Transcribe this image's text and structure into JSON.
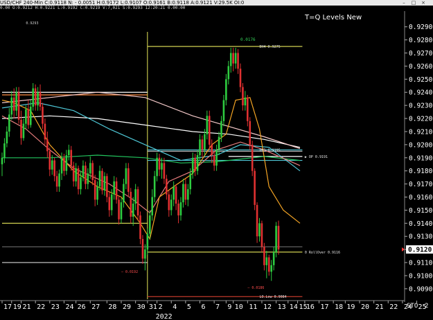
{
  "window": {
    "title": "USD/CHF  240-Min  C:0.9118  N: - 0.0051  H:0.9172  L:0.9107  O:0.9161  B:0.9118  A:0.9121  V:29.5K  OI:0",
    "ohlc_line": "0.00  O:0.9212  H:0.9221  L:0.9192  C:0.9219  V:7,021  S:0.9293  12:20:21  0.00:00",
    "controls": [
      "–",
      "□",
      "×"
    ]
  },
  "indicator_name": "T=Q Levels New",
  "chart_data": {
    "type": "candlestick",
    "symbol": "USD/CHF",
    "interval": "240-Min",
    "ylim": [
      0.9082,
      0.9302
    ],
    "y_ticks": [
      "0.9290",
      "0.9280",
      "0.9270",
      "0.9260",
      "0.9250",
      "0.9240",
      "0.9230",
      "0.9220",
      "0.9210",
      "0.9200",
      "0.9190",
      "0.9180",
      "0.9170",
      "0.9160",
      "0.9150",
      "0.9140",
      "0.9130",
      "0.9120",
      "0.9110",
      "0.9100",
      "0.9090"
    ],
    "x_labels": [
      {
        "label": "17",
        "i": 0
      },
      {
        "label": "19",
        "i": 4
      },
      {
        "label": "21",
        "i": 8
      },
      {
        "label": "22",
        "i": 14
      },
      {
        "label": "23",
        "i": 20
      },
      {
        "label": "24",
        "i": 26
      },
      {
        "label": "26",
        "i": 31
      },
      {
        "label": "27",
        "i": 37
      },
      {
        "label": "28",
        "i": 44
      },
      {
        "label": "29",
        "i": 50
      },
      {
        "label": "30",
        "i": 56
      },
      {
        "label": "31",
        "i": 61
      },
      {
        "label": "2",
        "i": 65
      },
      {
        "label": "4",
        "i": 71
      },
      {
        "label": "5",
        "i": 77
      },
      {
        "label": "6",
        "i": 83
      },
      {
        "label": "7",
        "i": 89
      },
      {
        "label": "9",
        "i": 94
      },
      {
        "label": "10",
        "i": 97
      },
      {
        "label": "11",
        "i": 103
      },
      {
        "label": "12",
        "i": 109
      },
      {
        "label": "13",
        "i": 115
      },
      {
        "label": "14",
        "i": 120
      },
      {
        "label": "15",
        "i": 124
      },
      {
        "label": "16",
        "i": 127
      },
      {
        "label": "17",
        "i": 133
      },
      {
        "label": "18",
        "i": 139
      },
      {
        "label": "19",
        "i": 144
      },
      {
        "label": "20",
        "i": 150
      },
      {
        "label": "21",
        "i": 156
      },
      {
        "label": "22",
        "i": 162
      },
      {
        "label": "24",
        "i": 168
      },
      {
        "label": "25",
        "i": 174
      }
    ],
    "year_label": "2022",
    "year_label_i": 65,
    "last_price": "0.9120",
    "last_label_left": "STO",
    "last_label_right": "2",
    "candles": [
      [
        0.9185,
        0.9194,
        0.9176,
        0.919
      ],
      [
        0.919,
        0.9205,
        0.9186,
        0.9201
      ],
      [
        0.9201,
        0.9214,
        0.9198,
        0.921
      ],
      [
        0.921,
        0.9228,
        0.9206,
        0.9223
      ],
      [
        0.9223,
        0.9241,
        0.9219,
        0.9236
      ],
      [
        0.9236,
        0.9243,
        0.922,
        0.9226
      ],
      [
        0.9226,
        0.9244,
        0.9222,
        0.924
      ],
      [
        0.924,
        0.9244,
        0.9216,
        0.9219
      ],
      [
        0.9219,
        0.9226,
        0.92,
        0.9205
      ],
      [
        0.9205,
        0.922,
        0.9203,
        0.9216
      ],
      [
        0.9216,
        0.923,
        0.9212,
        0.9227
      ],
      [
        0.9227,
        0.9234,
        0.9212,
        0.9215
      ],
      [
        0.9215,
        0.9234,
        0.9213,
        0.9229
      ],
      [
        0.9229,
        0.9247,
        0.9226,
        0.9243
      ],
      [
        0.9243,
        0.9246,
        0.9226,
        0.923
      ],
      [
        0.923,
        0.9244,
        0.9226,
        0.924
      ],
      [
        0.924,
        0.9246,
        0.9226,
        0.9229
      ],
      [
        0.9229,
        0.9232,
        0.9212,
        0.9216
      ],
      [
        0.9216,
        0.922,
        0.92,
        0.9204
      ],
      [
        0.9204,
        0.921,
        0.919,
        0.9195
      ],
      [
        0.9195,
        0.9198,
        0.9176,
        0.9181
      ],
      [
        0.9181,
        0.9192,
        0.9177,
        0.9188
      ],
      [
        0.9188,
        0.919,
        0.9172,
        0.9176
      ],
      [
        0.9176,
        0.918,
        0.9164,
        0.9168
      ],
      [
        0.9168,
        0.9181,
        0.9164,
        0.9178
      ],
      [
        0.9178,
        0.9194,
        0.9173,
        0.919
      ],
      [
        0.919,
        0.9193,
        0.9176,
        0.918
      ],
      [
        0.918,
        0.9196,
        0.9177,
        0.9192
      ],
      [
        0.9192,
        0.92,
        0.9188,
        0.9196
      ],
      [
        0.9196,
        0.9199,
        0.918,
        0.9184
      ],
      [
        0.9184,
        0.9187,
        0.9168,
        0.9172
      ],
      [
        0.9172,
        0.9186,
        0.9168,
        0.9182
      ],
      [
        0.9182,
        0.9184,
        0.9162,
        0.9166
      ],
      [
        0.9166,
        0.918,
        0.9162,
        0.9175
      ],
      [
        0.9175,
        0.9188,
        0.9172,
        0.9184
      ],
      [
        0.9184,
        0.9187,
        0.9166,
        0.917
      ],
      [
        0.917,
        0.9182,
        0.9166,
        0.9178
      ],
      [
        0.9178,
        0.9191,
        0.9174,
        0.9186
      ],
      [
        0.9186,
        0.9188,
        0.9169,
        0.9173
      ],
      [
        0.9173,
        0.9177,
        0.9153,
        0.9158
      ],
      [
        0.9158,
        0.9172,
        0.9154,
        0.9168
      ],
      [
        0.9168,
        0.9184,
        0.9165,
        0.918
      ],
      [
        0.918,
        0.9182,
        0.9162,
        0.9165
      ],
      [
        0.9165,
        0.9179,
        0.9161,
        0.9176
      ],
      [
        0.9176,
        0.9178,
        0.9156,
        0.916
      ],
      [
        0.916,
        0.9164,
        0.9145,
        0.915
      ],
      [
        0.915,
        0.9166,
        0.9146,
        0.9162
      ],
      [
        0.9162,
        0.9176,
        0.9158,
        0.9172
      ],
      [
        0.9172,
        0.9175,
        0.9155,
        0.9158
      ],
      [
        0.9158,
        0.9161,
        0.9139,
        0.9143
      ],
      [
        0.9143,
        0.9159,
        0.914,
        0.9156
      ],
      [
        0.9156,
        0.9174,
        0.9152,
        0.917
      ],
      [
        0.917,
        0.9186,
        0.9166,
        0.9182
      ],
      [
        0.9182,
        0.9186,
        0.916,
        0.9164
      ],
      [
        0.9164,
        0.9167,
        0.914,
        0.9145
      ],
      [
        0.9145,
        0.916,
        0.9138,
        0.9155
      ],
      [
        0.9155,
        0.917,
        0.915,
        0.9166
      ],
      [
        0.9166,
        0.9168,
        0.9142,
        0.9146
      ],
      [
        0.9146,
        0.9149,
        0.9124,
        0.9128
      ],
      [
        0.9128,
        0.9131,
        0.9109,
        0.9113
      ],
      [
        0.9113,
        0.9124,
        0.9104,
        0.912
      ],
      [
        0.912,
        0.9136,
        0.9116,
        0.9132
      ],
      [
        0.9132,
        0.915,
        0.9128,
        0.9146
      ],
      [
        0.9146,
        0.9166,
        0.9142,
        0.916
      ],
      [
        0.916,
        0.918,
        0.9156,
        0.9176
      ],
      [
        0.9176,
        0.9194,
        0.9172,
        0.919
      ],
      [
        0.919,
        0.9193,
        0.9176,
        0.9181
      ],
      [
        0.9181,
        0.919,
        0.9174,
        0.9186
      ],
      [
        0.9186,
        0.919,
        0.917,
        0.9174
      ],
      [
        0.9174,
        0.9177,
        0.9158,
        0.9162
      ],
      [
        0.9162,
        0.9165,
        0.9145,
        0.915
      ],
      [
        0.915,
        0.9162,
        0.9146,
        0.9158
      ],
      [
        0.9158,
        0.9172,
        0.9153,
        0.9168
      ],
      [
        0.9168,
        0.917,
        0.915,
        0.9155
      ],
      [
        0.9155,
        0.9158,
        0.914,
        0.9146
      ],
      [
        0.9146,
        0.916,
        0.9142,
        0.9156
      ],
      [
        0.9156,
        0.9174,
        0.9152,
        0.917
      ],
      [
        0.917,
        0.9174,
        0.9154,
        0.9158
      ],
      [
        0.9158,
        0.917,
        0.9153,
        0.9166
      ],
      [
        0.9166,
        0.9182,
        0.9162,
        0.9178
      ],
      [
        0.9178,
        0.9194,
        0.9174,
        0.919
      ],
      [
        0.919,
        0.9193,
        0.9176,
        0.918
      ],
      [
        0.918,
        0.9196,
        0.9177,
        0.9192
      ],
      [
        0.9192,
        0.9208,
        0.9188,
        0.9204
      ],
      [
        0.9204,
        0.9207,
        0.919,
        0.9196
      ],
      [
        0.9196,
        0.9212,
        0.9192,
        0.9208
      ],
      [
        0.9208,
        0.9226,
        0.9204,
        0.9222
      ],
      [
        0.9222,
        0.9226,
        0.9196,
        0.92
      ],
      [
        0.92,
        0.9204,
        0.9186,
        0.9192
      ],
      [
        0.9192,
        0.9195,
        0.918,
        0.9184
      ],
      [
        0.9184,
        0.92,
        0.918,
        0.9196
      ],
      [
        0.9196,
        0.921,
        0.9192,
        0.9206
      ],
      [
        0.9206,
        0.9222,
        0.9202,
        0.9218
      ],
      [
        0.9218,
        0.9238,
        0.9214,
        0.9234
      ],
      [
        0.9234,
        0.9254,
        0.923,
        0.925
      ],
      [
        0.925,
        0.9264,
        0.9246,
        0.926
      ],
      [
        0.926,
        0.9274,
        0.9255,
        0.927
      ],
      [
        0.927,
        0.9274,
        0.9256,
        0.9262
      ],
      [
        0.9262,
        0.9274,
        0.9258,
        0.927
      ],
      [
        0.927,
        0.9273,
        0.9254,
        0.9258
      ],
      [
        0.9258,
        0.9262,
        0.924,
        0.9244
      ],
      [
        0.9244,
        0.9247,
        0.9226,
        0.923
      ],
      [
        0.923,
        0.9241,
        0.9226,
        0.9236
      ],
      [
        0.9236,
        0.9238,
        0.9214,
        0.9218
      ],
      [
        0.9218,
        0.9221,
        0.9196,
        0.92
      ],
      [
        0.92,
        0.9203,
        0.9176,
        0.918
      ],
      [
        0.918,
        0.9182,
        0.915,
        0.9154
      ],
      [
        0.9154,
        0.9156,
        0.9125,
        0.913
      ],
      [
        0.913,
        0.9144,
        0.9126,
        0.914
      ],
      [
        0.914,
        0.9142,
        0.9118,
        0.9122
      ],
      [
        0.9122,
        0.9125,
        0.9104,
        0.9108
      ],
      [
        0.9108,
        0.9119,
        0.9098,
        0.9114
      ],
      [
        0.9114,
        0.9116,
        0.91,
        0.9103
      ],
      [
        0.9103,
        0.9112,
        0.9096,
        0.9108
      ],
      [
        0.9108,
        0.9122,
        0.9104,
        0.9118
      ],
      [
        0.9118,
        0.9141,
        0.9114,
        0.9138
      ],
      [
        0.9138,
        0.9142,
        0.9116,
        0.912
      ]
    ],
    "moving_averages": [
      {
        "color": "#ffffff",
        "values": [
          [
            0,
            0.922
          ],
          [
            20,
            0.9222
          ],
          [
            40,
            0.922
          ],
          [
            60,
            0.9215
          ],
          [
            80,
            0.921
          ],
          [
            95,
            0.9208
          ],
          [
            110,
            0.9204
          ],
          [
            125,
            0.9198
          ]
        ]
      },
      {
        "color": "#f4c9c9",
        "values": [
          [
            0,
            0.9232
          ],
          [
            20,
            0.9236
          ],
          [
            40,
            0.924
          ],
          [
            60,
            0.9236
          ],
          [
            80,
            0.9222
          ],
          [
            95,
            0.9214
          ],
          [
            110,
            0.9206
          ],
          [
            125,
            0.9197
          ]
        ]
      },
      {
        "color": "#4ec7d6",
        "values": [
          [
            0,
            0.9228
          ],
          [
            15,
            0.9232
          ],
          [
            30,
            0.9226
          ],
          [
            45,
            0.9212
          ],
          [
            60,
            0.92
          ],
          [
            75,
            0.9188
          ],
          [
            90,
            0.9192
          ],
          [
            100,
            0.92
          ],
          [
            112,
            0.9198
          ],
          [
            125,
            0.918
          ]
        ]
      },
      {
        "color": "#22c55e",
        "values": [
          [
            0,
            0.919
          ],
          [
            20,
            0.919
          ],
          [
            40,
            0.9192
          ],
          [
            60,
            0.919
          ],
          [
            75,
            0.9186
          ],
          [
            90,
            0.9187
          ],
          [
            110,
            0.9191
          ],
          [
            125,
            0.9188
          ]
        ]
      },
      {
        "color": "#e87d7d",
        "values": [
          [
            0,
            0.9222
          ],
          [
            10,
            0.9212
          ],
          [
            20,
            0.9196
          ],
          [
            30,
            0.9182
          ],
          [
            45,
            0.917
          ],
          [
            55,
            0.9158
          ],
          [
            62,
            0.9148
          ],
          [
            70,
            0.9172
          ],
          [
            80,
            0.918
          ],
          [
            90,
            0.9196
          ],
          [
            100,
            0.9202
          ],
          [
            110,
            0.9196
          ],
          [
            125,
            0.9184
          ]
        ]
      },
      {
        "color": "#f5a524",
        "values": [
          [
            0,
            0.9234
          ],
          [
            5,
            0.9232
          ],
          [
            12,
            0.9226
          ],
          [
            20,
            0.92
          ],
          [
            30,
            0.918
          ],
          [
            40,
            0.9168
          ],
          [
            50,
            0.916
          ],
          [
            58,
            0.914
          ],
          [
            62,
            0.9128
          ],
          [
            66,
            0.916
          ],
          [
            72,
            0.9168
          ],
          [
            80,
            0.9178
          ],
          [
            88,
            0.92
          ],
          [
            94,
            0.9208
          ],
          [
            98,
            0.9234
          ],
          [
            104,
            0.9236
          ],
          [
            108,
            0.9212
          ],
          [
            112,
            0.9168
          ],
          [
            118,
            0.915
          ],
          [
            125,
            0.914
          ]
        ]
      }
    ],
    "levels": [
      {
        "price": 0.9275,
        "from": 61,
        "to": 126,
        "color": "#e8e85a",
        "label": "DH4  0.9275",
        "label_i": 108,
        "peak_label": "0.0176",
        "peak_i": 100
      },
      {
        "price": 0.924,
        "from": 0,
        "to": 61,
        "color": "#ffffff"
      },
      {
        "price": 0.9238,
        "from": 0,
        "to": 61,
        "color": "#ff8c42"
      },
      {
        "price": 0.9196,
        "from": 61,
        "to": 126,
        "color": "#4ec7d6",
        "label": "DH3  0.9195",
        "label_i": 108
      },
      {
        "price": 0.9195,
        "from": 61,
        "to": 126,
        "color": "#d0d0d0"
      },
      {
        "price": 0.9191,
        "from": 95,
        "to": 126,
        "color": "#ffffff",
        "label": "▶  OP  0.9191",
        "label_i": 127
      },
      {
        "price": 0.9188,
        "from": 61,
        "to": 126,
        "color": "#4ec7d6"
      },
      {
        "price": 0.914,
        "from": 0,
        "to": 61,
        "color": "#e8e85a"
      },
      {
        "price": 0.9118,
        "from": 61,
        "to": 126,
        "color": "#e8e85a",
        "label": "0  RollOver  0.9116",
        "label_i": 127
      },
      {
        "price": 0.9122,
        "from": 0,
        "to": 126,
        "color": "#606060"
      },
      {
        "price": 0.911,
        "from": 0,
        "to": 61,
        "color": "#d8d8d8"
      },
      {
        "price": 0.9084,
        "from": 61,
        "to": 126,
        "color": "#c0392b",
        "label": "LO.Low  0.9084",
        "label_i": 108
      }
    ],
    "vertical_marker_i": 61,
    "annotations": [
      {
        "text": "0.9293",
        "i": 10,
        "price": 0.9292,
        "color": "#d0d0d0"
      },
      {
        "text": "– 0.0192",
        "i": 50,
        "price": 0.9102,
        "color": "#ff4d4d"
      },
      {
        "text": "– 0.0186",
        "i": 103,
        "price": 0.909,
        "color": "#ff4d4d"
      }
    ]
  }
}
